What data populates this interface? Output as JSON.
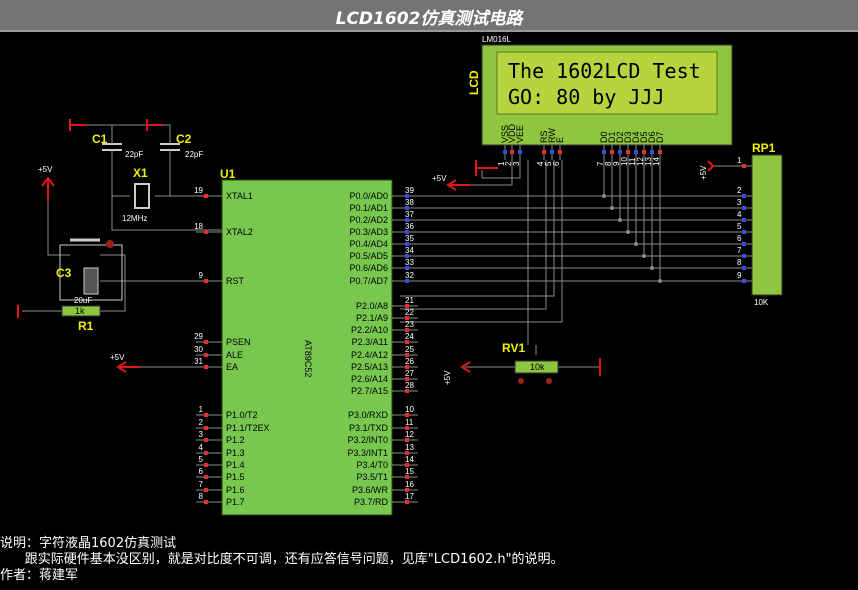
{
  "title": "LCD1602仿真测试电路",
  "lcd": {
    "model": "LM016L",
    "ref": "LCD",
    "line1": "The 1602LCD Test",
    "line2": "GO:   80  by JJJ",
    "pins": [
      "VSS",
      "VDD",
      "VEE",
      "RS",
      "RW",
      "E",
      "D0",
      "D1",
      "D2",
      "D3",
      "D4",
      "D5",
      "D6",
      "D7"
    ],
    "pin_numbers": [
      "1",
      "2",
      "3",
      "4",
      "5",
      "6",
      "7",
      "8",
      "9",
      "10",
      "11",
      "12",
      "13",
      "14"
    ]
  },
  "mcu": {
    "ref": "U1",
    "part": "AT89C52",
    "left_pins": [
      {
        "num": "19",
        "label": "XTAL1"
      },
      {
        "num": "18",
        "label": "XTAL2"
      },
      {
        "num": "9",
        "label": "RST"
      },
      {
        "num": "29",
        "label": "PSEN"
      },
      {
        "num": "30",
        "label": "ALE"
      },
      {
        "num": "31",
        "label": "EA"
      },
      {
        "num": "1",
        "label": "P1.0/T2"
      },
      {
        "num": "2",
        "label": "P1.1/T2EX"
      },
      {
        "num": "3",
        "label": "P1.2"
      },
      {
        "num": "4",
        "label": "P1.3"
      },
      {
        "num": "5",
        "label": "P1.4"
      },
      {
        "num": "6",
        "label": "P1.5"
      },
      {
        "num": "7",
        "label": "P1.6"
      },
      {
        "num": "8",
        "label": "P1.7"
      }
    ],
    "right_pins": [
      {
        "num": "39",
        "label": "P0.0/AD0"
      },
      {
        "num": "38",
        "label": "P0.1/AD1"
      },
      {
        "num": "37",
        "label": "P0.2/AD2"
      },
      {
        "num": "36",
        "label": "P0.3/AD3"
      },
      {
        "num": "35",
        "label": "P0.4/AD4"
      },
      {
        "num": "34",
        "label": "P0.5/AD5"
      },
      {
        "num": "33",
        "label": "P0.6/AD6"
      },
      {
        "num": "32",
        "label": "P0.7/AD7"
      },
      {
        "num": "21",
        "label": "P2.0/A8"
      },
      {
        "num": "22",
        "label": "P2.1/A9"
      },
      {
        "num": "23",
        "label": "P2.2/A10"
      },
      {
        "num": "24",
        "label": "P2.3/A11"
      },
      {
        "num": "25",
        "label": "P2.4/A12"
      },
      {
        "num": "26",
        "label": "P2.5/A13"
      },
      {
        "num": "27",
        "label": "P2.6/A14"
      },
      {
        "num": "28",
        "label": "P2.7/A15"
      },
      {
        "num": "10",
        "label": "P3.0/RXD"
      },
      {
        "num": "11",
        "label": "P3.1/TXD"
      },
      {
        "num": "12",
        "label": "P3.2/INT0"
      },
      {
        "num": "13",
        "label": "P3.3/INT1"
      },
      {
        "num": "14",
        "label": "P3.4/T0"
      },
      {
        "num": "15",
        "label": "P3.5/T1"
      },
      {
        "num": "16",
        "label": "P3.6/WR"
      },
      {
        "num": "17",
        "label": "P3.7/RD"
      }
    ]
  },
  "components": {
    "c1_ref": "C1",
    "c1_val": "22pF",
    "c2_ref": "C2",
    "c2_val": "22pF",
    "x1_ref": "X1",
    "x1_val": "12MHz",
    "c3_ref": "C3",
    "c3_val": "20uF",
    "r1_ref": "R1",
    "r1_val": "1k",
    "rv1_ref": "RV1",
    "rv1_val": "10k",
    "rp1_ref": "RP1",
    "rp1_val": "10K",
    "rp1_pins": [
      "1",
      "2",
      "3",
      "4",
      "5",
      "6",
      "7",
      "8",
      "9"
    ]
  },
  "power": {
    "vcc": "+5V"
  },
  "footer": {
    "line1": "说明：字符液晶1602仿真测试",
    "line2": "      跟实际硬件基本没区别，就是对比度不可调，还有应答信号问题，见库\"LCD1602.h\"的说明。",
    "line3": "作者：蒋建军"
  },
  "colors": {
    "wire": "#8c8c8c",
    "mcu_body": "#78c850",
    "lcd_body": "#8ec63f",
    "lcd_screen": "#b5d43d",
    "label": "#f0f000",
    "power": "#e01818"
  }
}
